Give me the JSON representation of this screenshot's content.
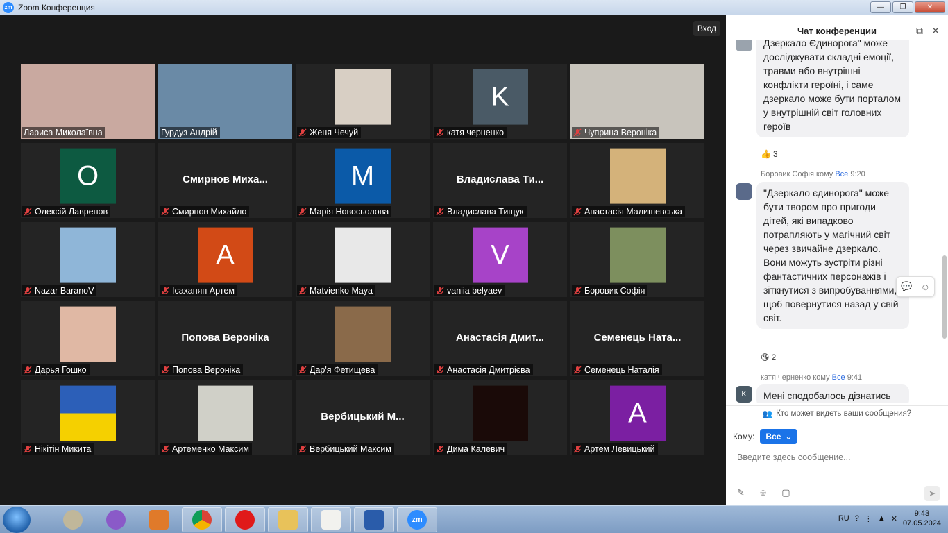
{
  "window": {
    "title": "Zoom Конференция",
    "logo_text": "zm",
    "minimize": "—",
    "maximize": "❐",
    "close": "✕"
  },
  "video": {
    "exit_label": "Вход",
    "tiles": [
      {
        "name": "Лариса Миколаївна",
        "kind": "photo",
        "muted": false,
        "bg": "#c9a9a0"
      },
      {
        "name": "Гурдуз Андрій",
        "kind": "photo",
        "muted": false,
        "bg": "#6a8aa6",
        "active": true
      },
      {
        "name": "Женя Чечуй",
        "kind": "thumb",
        "muted": true,
        "bg": "#d8cfc4"
      },
      {
        "name": "катя черненко",
        "kind": "letter",
        "letter": "K",
        "muted": true,
        "bg": "#4a5a66"
      },
      {
        "name": "Чуприна Вероніка",
        "kind": "photo",
        "muted": true,
        "bg": "#c8c4bc"
      },
      {
        "name": "Олексій Лавренов",
        "kind": "letter",
        "letter": "O",
        "muted": true,
        "bg": "#0d5a41"
      },
      {
        "name": "Смирнов Михайло",
        "kind": "text",
        "bigname": "Смирнов  Миха...",
        "muted": true
      },
      {
        "name": "Марія Новосьолова",
        "kind": "letter",
        "letter": "M",
        "muted": true,
        "bg": "#0b5aa8"
      },
      {
        "name": "Владислава Тищук",
        "kind": "text",
        "bigname": "Владислава  Ти...",
        "muted": true
      },
      {
        "name": "Анастасія Малишевська",
        "kind": "thumb",
        "muted": true,
        "bg": "#d4b27a"
      },
      {
        "name": "Nazar BaranoV",
        "kind": "thumb",
        "muted": true,
        "bg": "#8fb6d8"
      },
      {
        "name": "Ісаханян Артем",
        "kind": "letter",
        "letter": "A",
        "muted": true,
        "bg": "#d24a16"
      },
      {
        "name": "Matvienko Maya",
        "kind": "thumb",
        "muted": true,
        "bg": "#e8e8e8"
      },
      {
        "name": "vaniia belyaev",
        "kind": "letter",
        "letter": "V",
        "muted": true,
        "bg": "#a743c8"
      },
      {
        "name": "Боровик Софія",
        "kind": "thumb",
        "muted": true,
        "bg": "#7d8f5e"
      },
      {
        "name": "Дарья Гошко",
        "kind": "thumb",
        "muted": true,
        "bg": "#e0b8a4"
      },
      {
        "name": "Попова Вероніка",
        "kind": "text",
        "bigname": "Попова Вероніка",
        "muted": true
      },
      {
        "name": "Дар'я Фетищева",
        "kind": "thumb",
        "muted": true,
        "bg": "#8a6a4a"
      },
      {
        "name": "Анастасія Дмитрієва",
        "kind": "text",
        "bigname": "Анастасія  Дмит...",
        "muted": true
      },
      {
        "name": "Семенець Наталія",
        "kind": "text",
        "bigname": "Семенець  Ната...",
        "muted": true
      },
      {
        "name": "Нікітін Микита",
        "kind": "flag",
        "muted": true,
        "bg": "#2c5fb8"
      },
      {
        "name": "Артеменко Максим",
        "kind": "thumb",
        "muted": true,
        "bg": "#d0d0c8"
      },
      {
        "name": "Вербицький Максим",
        "kind": "text",
        "bigname": "Вербицький  М...",
        "muted": true
      },
      {
        "name": "Дима Калевич",
        "kind": "thumb",
        "muted": true,
        "bg": "#1a0a08"
      },
      {
        "name": "Артем Левицький",
        "kind": "letter",
        "letter": "A",
        "muted": true,
        "bg": "#7b1fa2"
      }
    ]
  },
  "chat": {
    "title": "Чат конференции",
    "messages": [
      {
        "text": "Дзеркало Єдинорога\" може досліджувати складні емоції, травми або внутрішні конфлікти героїні, і саме дзеркало може бути порталом у внутрішній світ головних героїв",
        "reaction_emoji": "👍",
        "reaction_count": "3"
      },
      {
        "sender": "Боровик Софія",
        "to_word": "кому",
        "to": "Все",
        "time": "9:20",
        "text": "\"Дзеркало єдинорога\" може бути твором про пригоди дітей, які випадково потрапляють у магічний світ через звичайне дзеркало. Вони можуть зустріти різні фантастичних персонажів і зіткнутися з випробуваннями, щоб повернутися назад у свій світ.",
        "reaction_emoji": "😘",
        "reaction_count": "2"
      },
      {
        "sender": "катя черненко",
        "to_word": "кому",
        "to": "Все",
        "time": "9:41",
        "avatar_letter": "K",
        "text": "Мені сподобалось дізнатись"
      }
    ],
    "who_can_see": "Кто может видеть ваши сообщения?",
    "to_label": "Кому:",
    "to_value": "Все",
    "input_placeholder": "Введите здесь сообщение..."
  },
  "taskbar": {
    "lang": "RU",
    "time": "9:43",
    "date": "07.05.2024",
    "zoom_label": "zm"
  }
}
